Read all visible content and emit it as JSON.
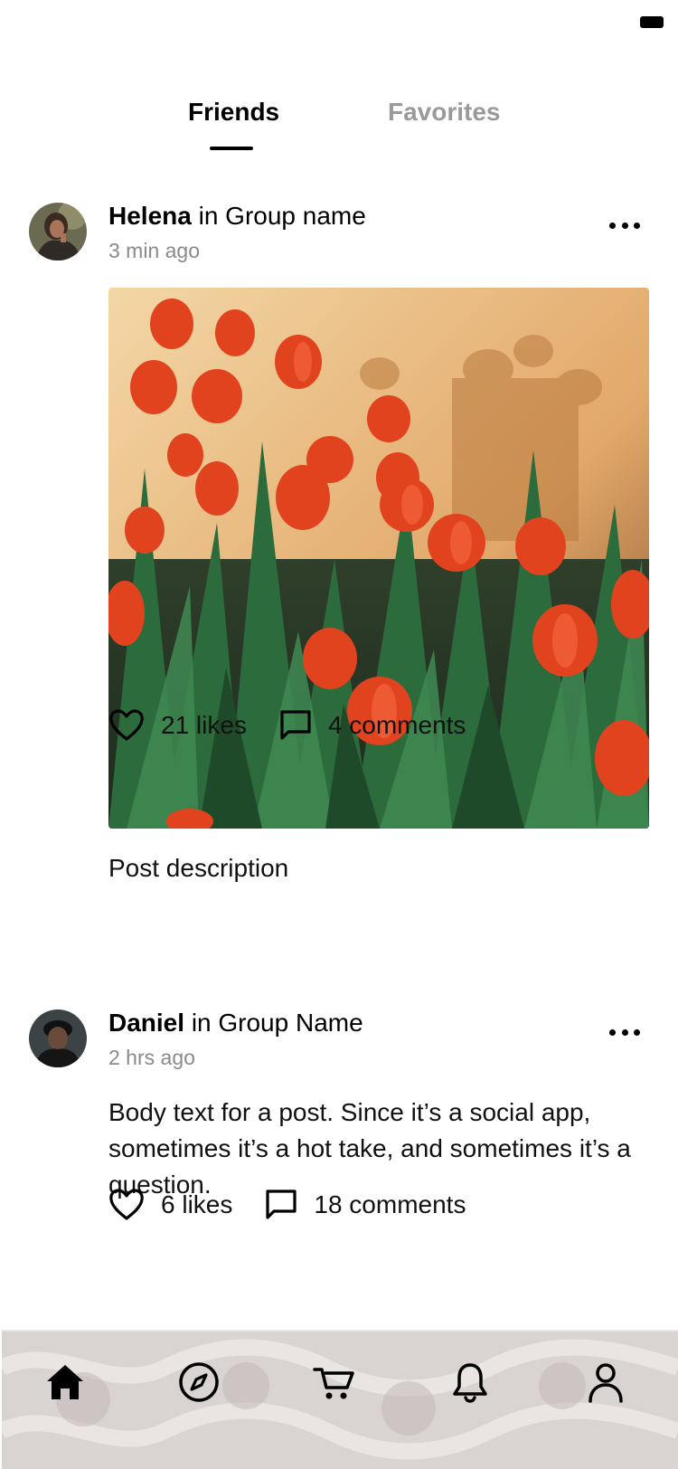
{
  "tabs": {
    "friends": "Friends",
    "favorites": "Favorites"
  },
  "posts": [
    {
      "author": "Helena",
      "group": "in Group name",
      "time": "3 min ago",
      "description": "Post description",
      "likes": "21 likes",
      "comments": "4 comments"
    },
    {
      "author": "Daniel",
      "group": "in Group Name",
      "time": "2 hrs ago",
      "body": "Body text for a post. Since it’s a social app, sometimes it’s a hot take, and sometimes it’s a question.",
      "likes": "6 likes",
      "comments": "18 comments"
    }
  ],
  "nav": [
    "home-icon",
    "compass-icon",
    "cart-icon",
    "bell-icon",
    "profile-icon"
  ],
  "colors": {
    "active_tab": "#000000",
    "inactive_tab": "#9a9a9a",
    "timestamp": "#8a8a8a"
  }
}
